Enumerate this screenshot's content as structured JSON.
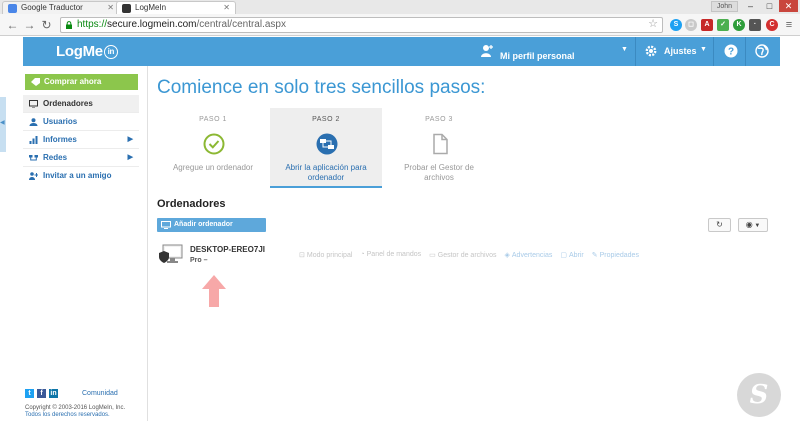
{
  "browser": {
    "tabs": [
      {
        "title": "Google Traductor"
      },
      {
        "title": "LogMeIn"
      }
    ],
    "url_scheme": "https://",
    "url_host": "secure.logmein.com",
    "url_path": "/central/central.aspx",
    "user_badge": "John"
  },
  "header": {
    "logo_text": "LogMe",
    "logo_in": "in",
    "profile_label": "Mi perfil personal",
    "settings_label": "Ajustes"
  },
  "sidebar": {
    "buy_label": "Comprar ahora",
    "items": [
      {
        "label": "Ordenadores"
      },
      {
        "label": "Usuarios"
      },
      {
        "label": "Informes"
      },
      {
        "label": "Redes"
      },
      {
        "label": "Invitar a un amigo"
      }
    ],
    "community_label": "Comunidad",
    "copyright": "Copyright © 2003-2016 LogMeIn, Inc.",
    "rights": "Todos los derechos reservados."
  },
  "main": {
    "title": "Comience en solo tres sencillos pasos:",
    "steps": [
      {
        "number": "PASO 1",
        "label": "Agregue un ordenador"
      },
      {
        "number": "PASO 2",
        "label": "Abrir la aplicación para ordenador"
      },
      {
        "number": "PASO 3",
        "label": "Probar el Gestor de archivos"
      }
    ],
    "computers_title": "Ordenadores",
    "add_button": "Añadir ordenador",
    "computer": {
      "name": "DESKTOP-EREO7JI",
      "plan": "Pro –"
    },
    "actions": [
      {
        "label": "Modo principal"
      },
      {
        "label": "Panel de mandos"
      },
      {
        "label": "Gestor de archivos"
      },
      {
        "label": "Advertencias"
      },
      {
        "label": "Abrir"
      },
      {
        "label": "Propiedades"
      }
    ]
  },
  "colors": {
    "header_blue": "#4a9fd8",
    "buy_green": "#8cc64c",
    "title_blue": "#3b97d3",
    "arrow_pink": "#f7a8a8"
  }
}
